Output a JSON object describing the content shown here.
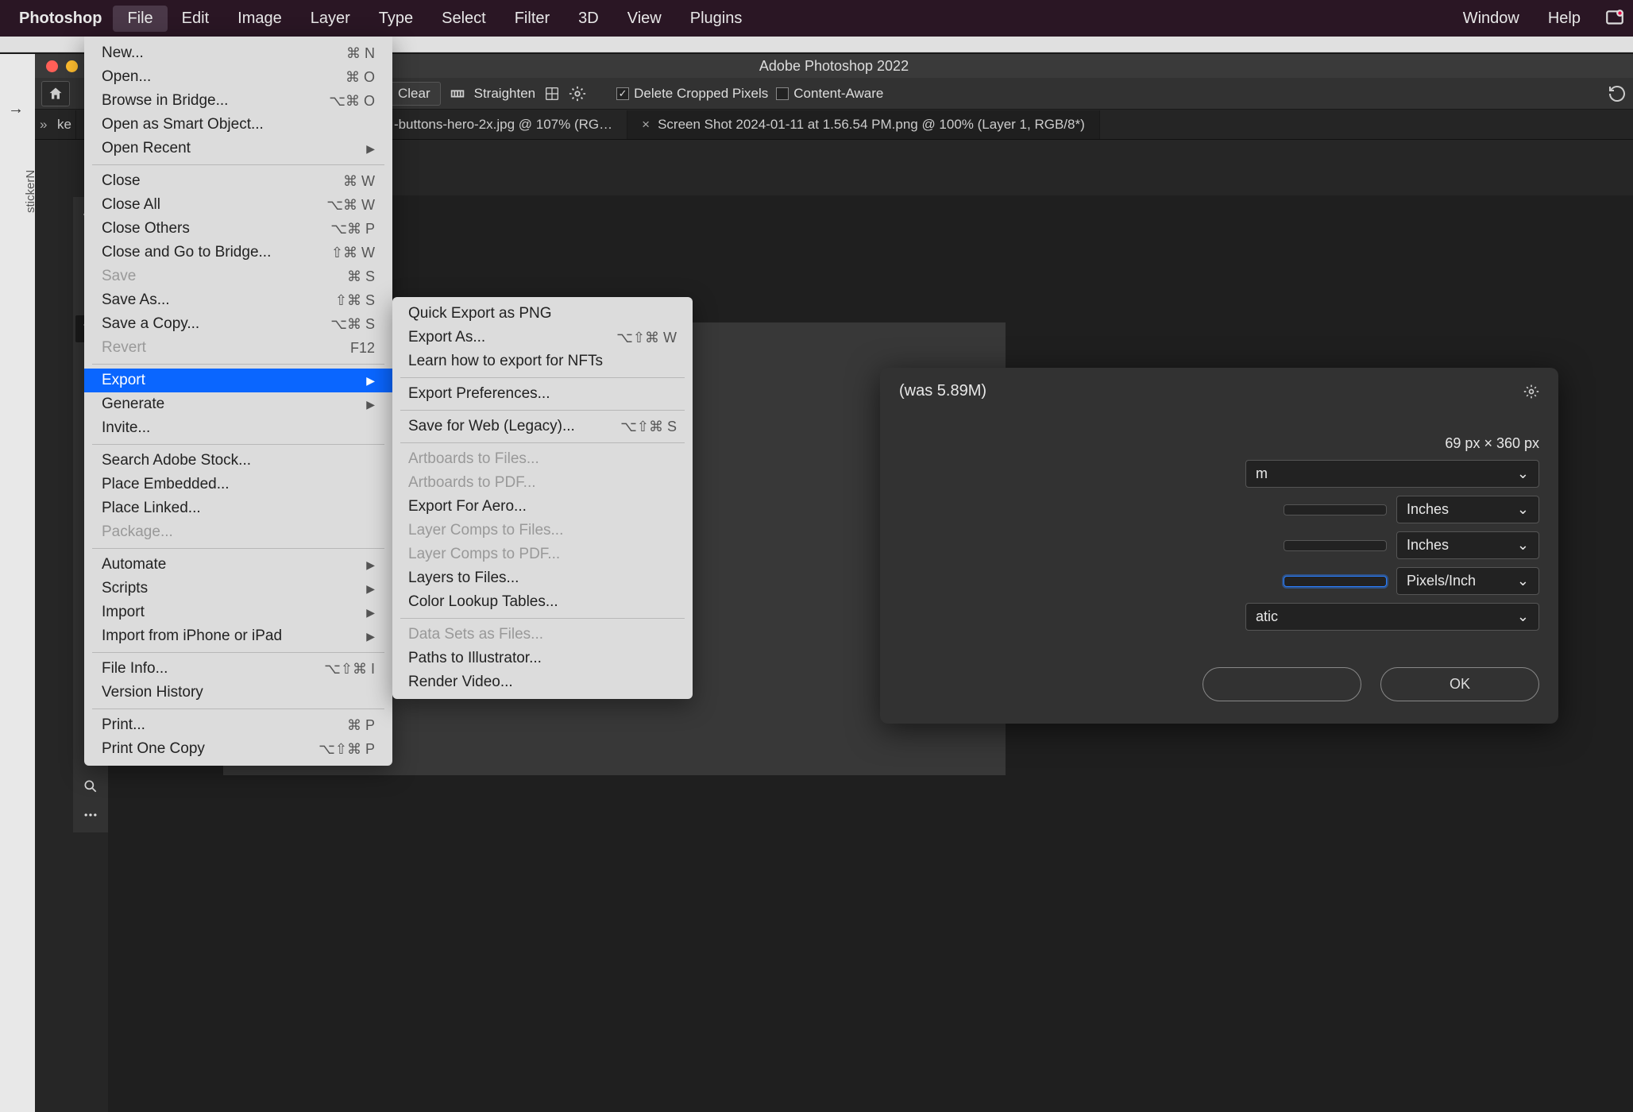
{
  "menubar": {
    "app": "Photoshop",
    "items": [
      "File",
      "Edit",
      "Image",
      "Layer",
      "Type",
      "Select",
      "Filter",
      "3D",
      "View",
      "Plugins"
    ],
    "right": [
      "Window",
      "Help"
    ]
  },
  "window_title": "Adobe Photoshop 2022",
  "options_bar": {
    "clear": "Clear",
    "straighten": "Straighten",
    "delete_cropped": "Delete Cropped Pixels",
    "content_aware": "Content-Aware"
  },
  "tabs": [
    {
      "label": "ke",
      "close": "×"
    },
    {
      "label": "-buttons-hero-2x.jpg @ 107% (RG…",
      "close": "×"
    },
    {
      "label": "Screen Shot 2024-01-11 at 1.56.54 PM.png @ 100% (Layer 1, RGB/8*)",
      "close": "×"
    }
  ],
  "partial_panel_label": "stickerN",
  "file_menu": {
    "groups": [
      [
        {
          "label": "New...",
          "shortcut": "⌘ N"
        },
        {
          "label": "Open...",
          "shortcut": "⌘ O"
        },
        {
          "label": "Browse in Bridge...",
          "shortcut": "⌥⌘ O"
        },
        {
          "label": "Open as Smart Object..."
        },
        {
          "label": "Open Recent",
          "submenu": true
        }
      ],
      [
        {
          "label": "Close",
          "shortcut": "⌘ W"
        },
        {
          "label": "Close All",
          "shortcut": "⌥⌘ W"
        },
        {
          "label": "Close Others",
          "shortcut": "⌥⌘ P"
        },
        {
          "label": "Close and Go to Bridge...",
          "shortcut": "⇧⌘ W"
        },
        {
          "label": "Save",
          "shortcut": "⌘ S",
          "disabled": true
        },
        {
          "label": "Save As...",
          "shortcut": "⇧⌘ S"
        },
        {
          "label": "Save a Copy...",
          "shortcut": "⌥⌘ S"
        },
        {
          "label": "Revert",
          "shortcut": "F12",
          "disabled": true
        }
      ],
      [
        {
          "label": "Export",
          "submenu": true,
          "highlight": true
        },
        {
          "label": "Generate",
          "submenu": true
        },
        {
          "label": "Invite..."
        }
      ],
      [
        {
          "label": "Search Adobe Stock..."
        },
        {
          "label": "Place Embedded..."
        },
        {
          "label": "Place Linked..."
        },
        {
          "label": "Package...",
          "disabled": true
        }
      ],
      [
        {
          "label": "Automate",
          "submenu": true
        },
        {
          "label": "Scripts",
          "submenu": true
        },
        {
          "label": "Import",
          "submenu": true
        },
        {
          "label": "Import from iPhone or iPad",
          "submenu": true
        }
      ],
      [
        {
          "label": "File Info...",
          "shortcut": "⌥⇧⌘ I"
        },
        {
          "label": "Version History"
        }
      ],
      [
        {
          "label": "Print...",
          "shortcut": "⌘ P"
        },
        {
          "label": "Print One Copy",
          "shortcut": "⌥⇧⌘ P"
        }
      ]
    ]
  },
  "export_submenu": {
    "groups": [
      [
        {
          "label": "Quick Export as PNG"
        },
        {
          "label": "Export As...",
          "shortcut": "⌥⇧⌘ W"
        },
        {
          "label": "Learn how to export for NFTs"
        }
      ],
      [
        {
          "label": "Export Preferences..."
        }
      ],
      [
        {
          "label": "Save for Web (Legacy)...",
          "shortcut": "⌥⇧⌘ S"
        }
      ],
      [
        {
          "label": "Artboards to Files...",
          "disabled": true
        },
        {
          "label": "Artboards to PDF...",
          "disabled": true
        },
        {
          "label": "Export For Aero..."
        },
        {
          "label": "Layer Comps to Files...",
          "disabled": true
        },
        {
          "label": "Layer Comps to PDF...",
          "disabled": true
        },
        {
          "label": "Layers to Files..."
        },
        {
          "label": "Color Lookup Tables..."
        }
      ],
      [
        {
          "label": "Data Sets as Files...",
          "disabled": true
        },
        {
          "label": "Paths to Illustrator..."
        },
        {
          "label": "Render Video..."
        }
      ]
    ]
  },
  "dialog": {
    "header_suffix": "(was 5.89M)",
    "dimensions_line": "69 px  ×  360 px",
    "fit_partial": "m",
    "unit_width": "Inches",
    "unit_height": "Inches",
    "resolution_unit": "Pixels/Inch",
    "resample_partial": "atic",
    "ok": "OK"
  }
}
